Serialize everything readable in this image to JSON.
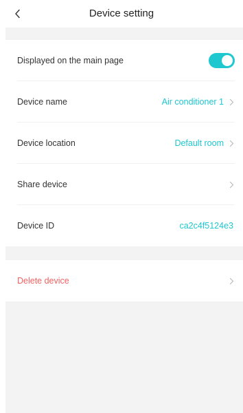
{
  "header": {
    "title": "Device setting",
    "back_icon": "chevron-left-icon"
  },
  "settings": {
    "show_on_main": {
      "label": "Displayed on the main page",
      "enabled": true
    },
    "device_name": {
      "label": "Device name",
      "value": "Air conditioner 1"
    },
    "device_location": {
      "label": "Device location",
      "value": "Default room"
    },
    "share_device": {
      "label": "Share device"
    },
    "device_id": {
      "label": "Device ID",
      "value": "ca2c4f5124e3"
    }
  },
  "actions": {
    "delete": {
      "label": "Delete device"
    }
  },
  "colors": {
    "accent": "#1fc7cf",
    "danger": "#f06262",
    "background": "#f3f3f3"
  }
}
